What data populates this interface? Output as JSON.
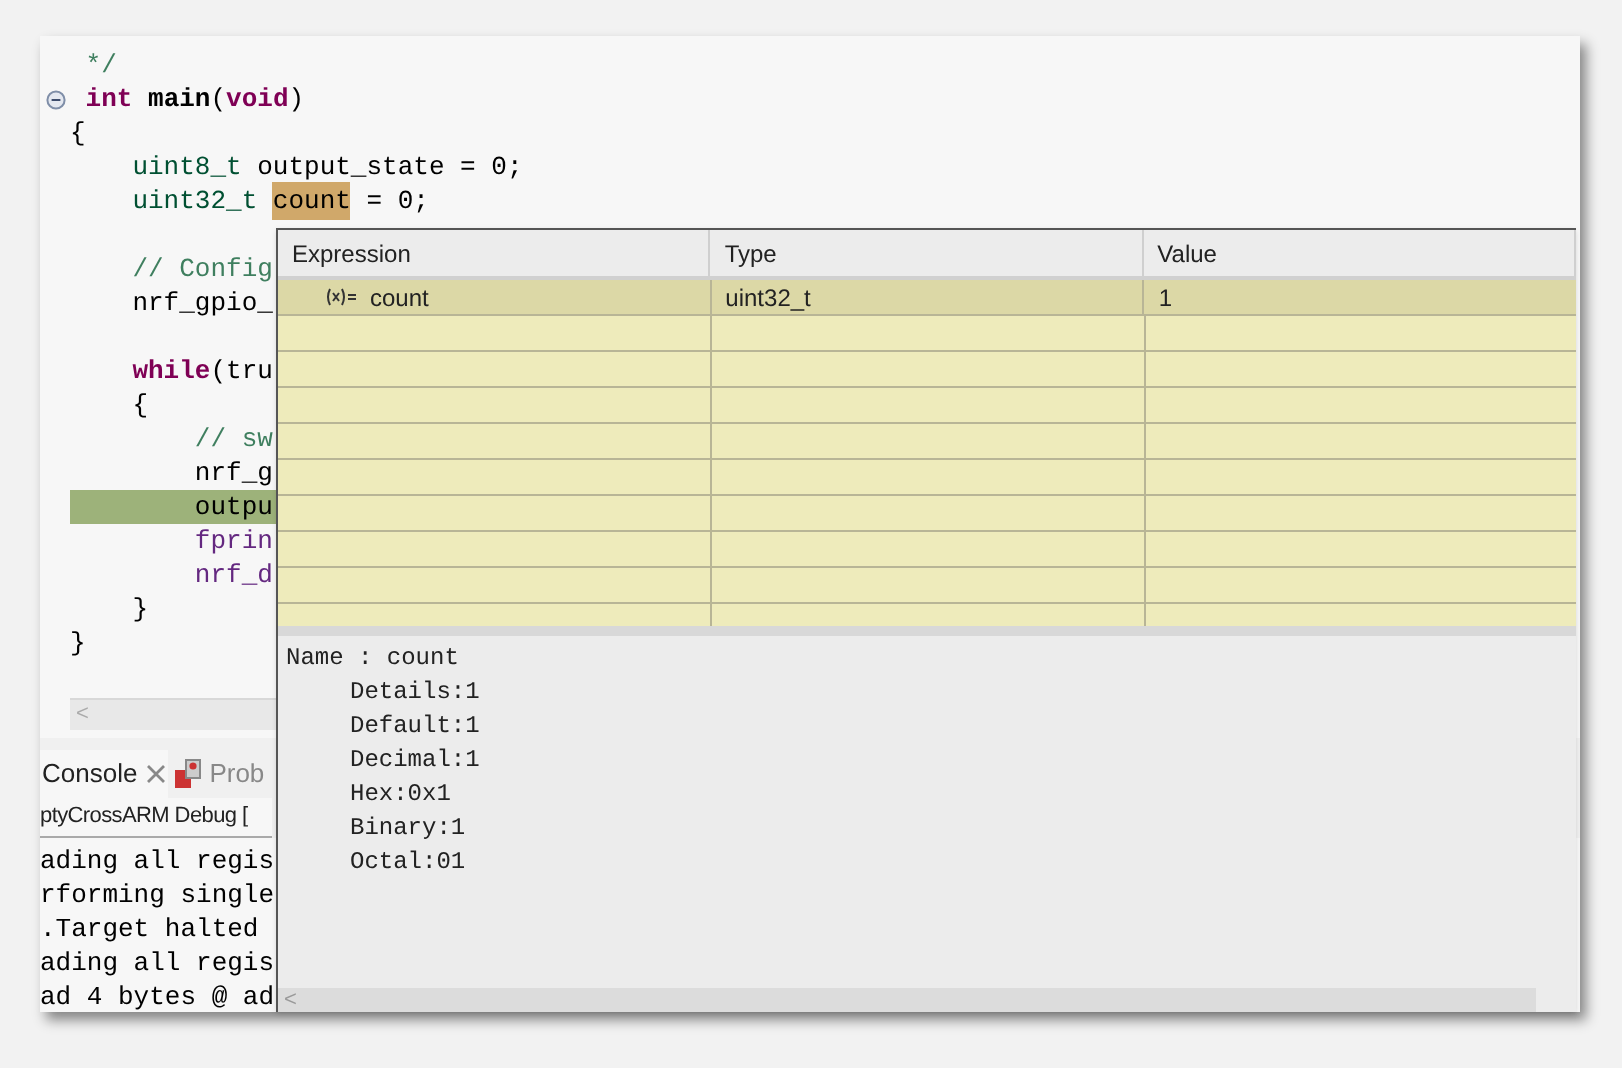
{
  "editor": {
    "lines": [
      {
        "segments": [
          {
            "text": " */",
            "kind": "comment"
          }
        ]
      },
      {
        "fold": true,
        "segments": [
          {
            "text": " int",
            "kind": "keyword"
          },
          {
            "text": " main",
            "kind": "bold"
          },
          {
            "text": "(",
            "kind": "plain"
          },
          {
            "text": "void",
            "kind": "keyword"
          },
          {
            "text": ")",
            "kind": "plain"
          }
        ]
      },
      {
        "segments": [
          {
            "text": "{",
            "kind": "plain"
          }
        ]
      },
      {
        "segments": [
          {
            "text": "    uint8_t",
            "kind": "type"
          },
          {
            "text": " output_state = 0;",
            "kind": "plain"
          }
        ]
      },
      {
        "segments": [
          {
            "text": "    uint32_t ",
            "kind": "type"
          },
          {
            "text": "count",
            "kind": "occurrence"
          },
          {
            "text": " = 0;",
            "kind": "plain"
          }
        ]
      },
      {
        "blank_line_before": true,
        "segments": [
          {
            "text": "    // Config",
            "kind": "comment"
          }
        ]
      },
      {
        "segments": [
          {
            "text": "    nrf_gpio_",
            "kind": "plain"
          }
        ]
      },
      {
        "blank_line_before": true,
        "segments": [
          {
            "text": "    while",
            "kind": "keyword"
          },
          {
            "text": "(tru",
            "kind": "plain"
          }
        ]
      },
      {
        "segments": [
          {
            "text": "    {",
            "kind": "plain"
          }
        ]
      },
      {
        "segments": [
          {
            "text": "        // sw",
            "kind": "comment"
          }
        ]
      },
      {
        "segments": [
          {
            "text": "        nrf_g",
            "kind": "plain"
          }
        ]
      },
      {
        "current": true,
        "segments": [
          {
            "text": "        outpu",
            "kind": "plain"
          }
        ]
      },
      {
        "segments": [
          {
            "text": "        fprin",
            "kind": "call"
          }
        ]
      },
      {
        "segments": [
          {
            "text": "        nrf_d",
            "kind": "call"
          }
        ]
      },
      {
        "segments": [
          {
            "text": "    }",
            "kind": "plain"
          }
        ]
      },
      {
        "segments": [
          {
            "text": "}",
            "kind": "plain"
          }
        ]
      }
    ],
    "scroll_arrow": "<"
  },
  "console": {
    "tabs": [
      {
        "label": "Console",
        "selected": true,
        "kind": "console"
      },
      {
        "label": "Prob",
        "selected": false,
        "kind": "problems"
      }
    ],
    "launch": "ptyCrossARM Debug [",
    "lines": [
      "ading all regis",
      "rforming single",
      ".Target halted",
      "ading all regis",
      "ad 4 bytes @ ad"
    ]
  },
  "expressions": {
    "columns": [
      "Expression",
      "Type",
      "Value"
    ],
    "rows": [
      {
        "selected": true,
        "expression": "count",
        "type": "uint32_t",
        "value": "1"
      }
    ],
    "details": {
      "name": "Name : count",
      "lines": [
        "Details:1",
        "Default:1",
        "Decimal:1",
        "Hex:0x1",
        "Binary:1",
        "Octal:01"
      ]
    },
    "scroll_arrow": "<"
  }
}
